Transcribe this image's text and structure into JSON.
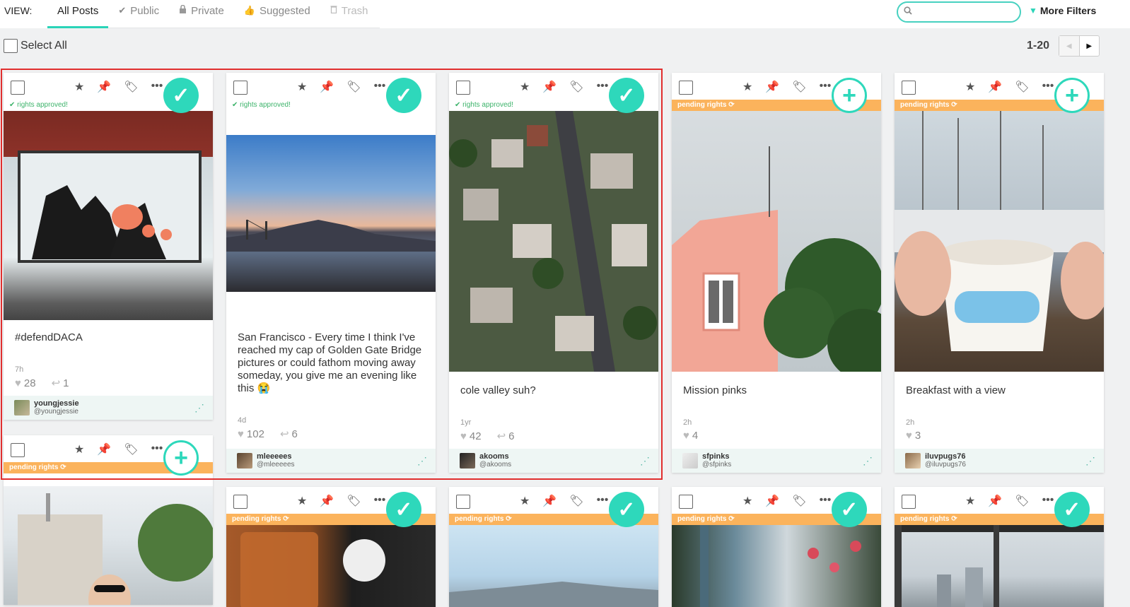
{
  "header": {
    "view_label": "VIEW:",
    "tabs": [
      {
        "label": "All Posts",
        "icon": "none",
        "active": true
      },
      {
        "label": "Public",
        "icon": "check-icon"
      },
      {
        "label": "Private",
        "icon": "lock-icon"
      },
      {
        "label": "Suggested",
        "icon": "thumbs-up-icon"
      },
      {
        "label": "Trash",
        "icon": "trash-icon",
        "disabled": true
      }
    ],
    "search_placeholder": "",
    "more_filters": "More Filters"
  },
  "toolbar": {
    "select_all": "Select All",
    "range": "1-20"
  },
  "colors": {
    "accent": "#2ed8bb",
    "pending": "#fbb35c",
    "approved_text": "#3cb36a",
    "pin_active": "#1d2f9e",
    "highlight": "#e12e2e"
  },
  "posts": [
    {
      "rights": "rights approved!",
      "status": "approved",
      "caption": "#defendDACA",
      "age": "7h",
      "likes": "28",
      "comments": "1",
      "username": "youngjessie",
      "handle": "@youngjessie"
    },
    {
      "rights": "rights approved!",
      "status": "approved",
      "caption": "San Francisco - Every time I think I've reached my cap of Golden Gate Bridge pictures or could fathom moving away someday, you give me an evening like this 😭",
      "age": "4d",
      "likes": "102",
      "comments": "6",
      "username": "mleeeees",
      "handle": "@mleeeees"
    },
    {
      "rights": "rights approved!",
      "status": "approved",
      "caption": "cole valley suh?",
      "age": "1yr",
      "likes": "42",
      "comments": "6",
      "username": "akooms",
      "handle": "@akooms"
    },
    {
      "rights": "pending rights",
      "status": "pending",
      "caption": "Mission pinks",
      "age": "2h",
      "likes": "4",
      "comments": "",
      "username": "sfpinks",
      "handle": "@sfpinks"
    },
    {
      "rights": "pending rights",
      "status": "pending",
      "caption": "Breakfast with a view",
      "age": "2h",
      "likes": "3",
      "comments": "",
      "username": "iluvpugs76",
      "handle": "@iluvpugs76"
    },
    {
      "rights": "pending rights",
      "status": "pending"
    },
    {
      "rights": "pending rights",
      "status": "approved"
    },
    {
      "rights": "pending rights",
      "status": "approved"
    },
    {
      "rights": "pending rights",
      "status": "approved"
    },
    {
      "rights": "pending rights",
      "status": "approved"
    }
  ]
}
